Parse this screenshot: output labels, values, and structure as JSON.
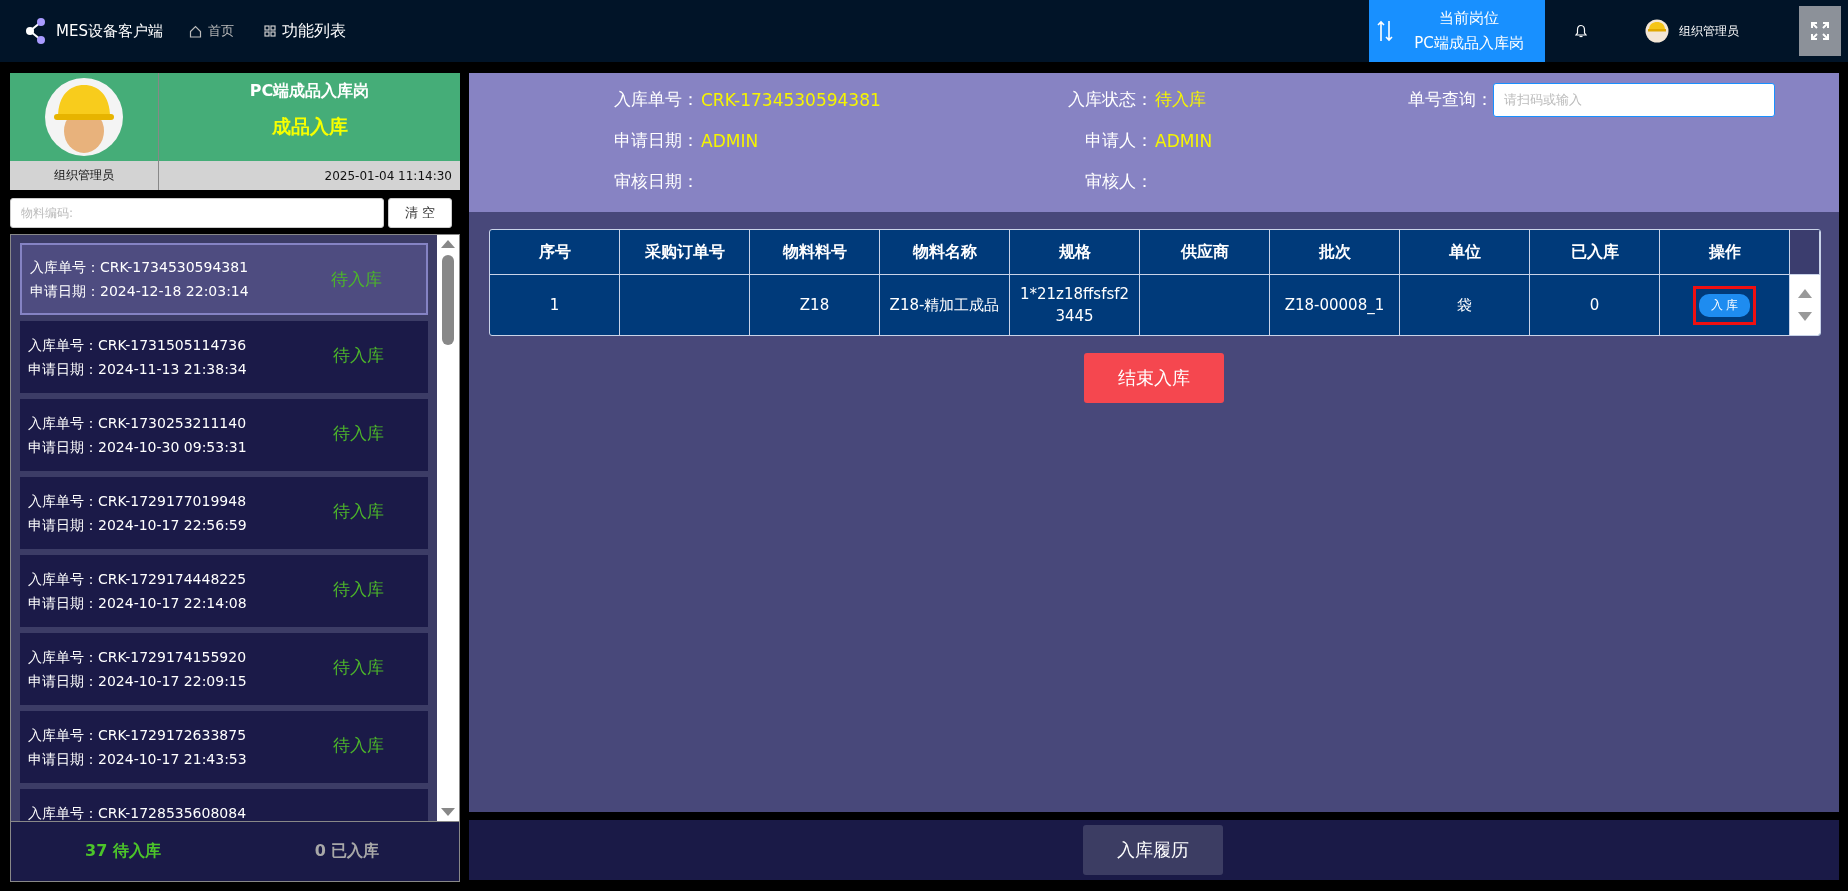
{
  "top_bar": {
    "app_title": "MES设备客户端",
    "nav": [
      {
        "label": "首页",
        "kind": "home"
      },
      {
        "label": "功能列表",
        "kind": "grid"
      }
    ],
    "station": {
      "label": "当前岗位",
      "value": "PC端成品入库岗"
    },
    "user": {
      "name": "组织管理员"
    }
  },
  "left_panel": {
    "station_title": "PC端成品入库岗",
    "function_title": "成品入库",
    "user_name": "组织管理员",
    "datetime": "2025-01-04 11:14:30",
    "search": {
      "placeholder": "物料编码:"
    },
    "clear_button": "清 空",
    "orders": [
      {
        "number": "入库单号：CRK-1734530594381",
        "date": "申请日期：2024-12-18 22:03:14",
        "status": "待入库",
        "selected": true
      },
      {
        "number": "入库单号：CRK-1731505114736",
        "date": "申请日期：2024-11-13 21:38:34",
        "status": "待入库",
        "selected": false
      },
      {
        "number": "入库单号：CRK-1730253211140",
        "date": "申请日期：2024-10-30 09:53:31",
        "status": "待入库",
        "selected": false
      },
      {
        "number": "入库单号：CRK-1729177019948",
        "date": "申请日期：2024-10-17 22:56:59",
        "status": "待入库",
        "selected": false
      },
      {
        "number": "入库单号：CRK-1729174448225",
        "date": "申请日期：2024-10-17 22:14:08",
        "status": "待入库",
        "selected": false
      },
      {
        "number": "入库单号：CRK-1729174155920",
        "date": "申请日期：2024-10-17 22:09:15",
        "status": "待入库",
        "selected": false
      },
      {
        "number": "入库单号：CRK-1729172633875",
        "date": "申请日期：2024-10-17 21:43:53",
        "status": "待入库",
        "selected": false
      },
      {
        "number": "入库单号：CRK-1728535608084",
        "selected": false
      }
    ],
    "footer": [
      {
        "text": "37 待入库",
        "kind": "pending"
      },
      {
        "text": "0 已入库",
        "kind": "done"
      }
    ]
  },
  "info": {
    "columns": [
      [
        {
          "label": "入库单号：",
          "value": "CRK-1734530594381"
        },
        {
          "label": "申请日期：",
          "value": "ADMIN"
        },
        {
          "label": "审核日期："
        }
      ],
      [
        {
          "label": "入库状态：",
          "value": "待入库"
        },
        {
          "label": "申请人：",
          "value": "ADMIN"
        },
        {
          "label": "审核人："
        }
      ],
      [
        {
          "label": "单号查询：",
          "placeholder": "请扫码或输入"
        }
      ]
    ]
  },
  "table": {
    "columns": [
      "序号",
      "采购订单号",
      "物料料号",
      "物料名称",
      "规格",
      "供应商",
      "批次",
      "单位",
      "已入库",
      "操作"
    ],
    "rows": [
      {
        "cells": [
          "1",
          "",
          "Z18",
          "Z18-精加工成品",
          "1*21z18ffsfsf23445",
          "",
          "Z18-00008_1",
          "袋",
          "0"
        ],
        "action": "入 库"
      }
    ]
  },
  "finish_button": "结束入库",
  "history_button": "入库履历"
}
